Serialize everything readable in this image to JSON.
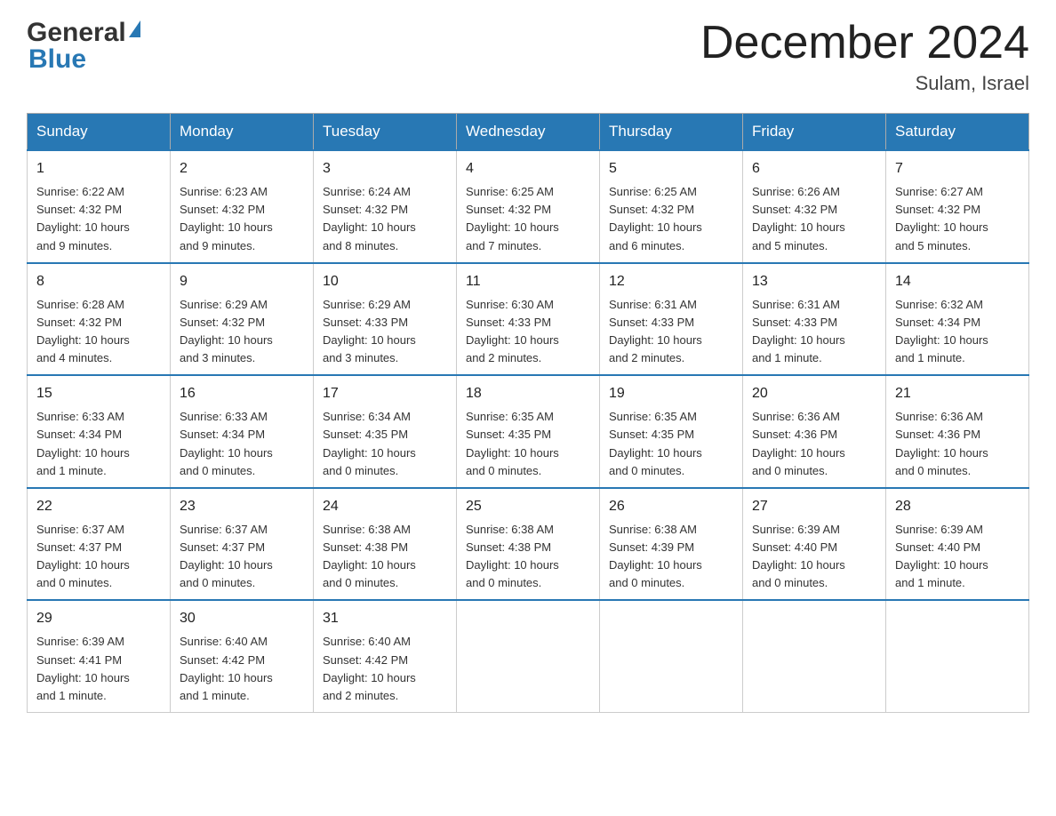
{
  "header": {
    "month_title": "December 2024",
    "location": "Sulam, Israel"
  },
  "days_of_week": [
    "Sunday",
    "Monday",
    "Tuesday",
    "Wednesday",
    "Thursday",
    "Friday",
    "Saturday"
  ],
  "weeks": [
    [
      {
        "day": "1",
        "sunrise": "6:22 AM",
        "sunset": "4:32 PM",
        "daylight": "10 hours and 9 minutes."
      },
      {
        "day": "2",
        "sunrise": "6:23 AM",
        "sunset": "4:32 PM",
        "daylight": "10 hours and 9 minutes."
      },
      {
        "day": "3",
        "sunrise": "6:24 AM",
        "sunset": "4:32 PM",
        "daylight": "10 hours and 8 minutes."
      },
      {
        "day": "4",
        "sunrise": "6:25 AM",
        "sunset": "4:32 PM",
        "daylight": "10 hours and 7 minutes."
      },
      {
        "day": "5",
        "sunrise": "6:25 AM",
        "sunset": "4:32 PM",
        "daylight": "10 hours and 6 minutes."
      },
      {
        "day": "6",
        "sunrise": "6:26 AM",
        "sunset": "4:32 PM",
        "daylight": "10 hours and 5 minutes."
      },
      {
        "day": "7",
        "sunrise": "6:27 AM",
        "sunset": "4:32 PM",
        "daylight": "10 hours and 5 minutes."
      }
    ],
    [
      {
        "day": "8",
        "sunrise": "6:28 AM",
        "sunset": "4:32 PM",
        "daylight": "10 hours and 4 minutes."
      },
      {
        "day": "9",
        "sunrise": "6:29 AM",
        "sunset": "4:32 PM",
        "daylight": "10 hours and 3 minutes."
      },
      {
        "day": "10",
        "sunrise": "6:29 AM",
        "sunset": "4:33 PM",
        "daylight": "10 hours and 3 minutes."
      },
      {
        "day": "11",
        "sunrise": "6:30 AM",
        "sunset": "4:33 PM",
        "daylight": "10 hours and 2 minutes."
      },
      {
        "day": "12",
        "sunrise": "6:31 AM",
        "sunset": "4:33 PM",
        "daylight": "10 hours and 2 minutes."
      },
      {
        "day": "13",
        "sunrise": "6:31 AM",
        "sunset": "4:33 PM",
        "daylight": "10 hours and 1 minute."
      },
      {
        "day": "14",
        "sunrise": "6:32 AM",
        "sunset": "4:34 PM",
        "daylight": "10 hours and 1 minute."
      }
    ],
    [
      {
        "day": "15",
        "sunrise": "6:33 AM",
        "sunset": "4:34 PM",
        "daylight": "10 hours and 1 minute."
      },
      {
        "day": "16",
        "sunrise": "6:33 AM",
        "sunset": "4:34 PM",
        "daylight": "10 hours and 0 minutes."
      },
      {
        "day": "17",
        "sunrise": "6:34 AM",
        "sunset": "4:35 PM",
        "daylight": "10 hours and 0 minutes."
      },
      {
        "day": "18",
        "sunrise": "6:35 AM",
        "sunset": "4:35 PM",
        "daylight": "10 hours and 0 minutes."
      },
      {
        "day": "19",
        "sunrise": "6:35 AM",
        "sunset": "4:35 PM",
        "daylight": "10 hours and 0 minutes."
      },
      {
        "day": "20",
        "sunrise": "6:36 AM",
        "sunset": "4:36 PM",
        "daylight": "10 hours and 0 minutes."
      },
      {
        "day": "21",
        "sunrise": "6:36 AM",
        "sunset": "4:36 PM",
        "daylight": "10 hours and 0 minutes."
      }
    ],
    [
      {
        "day": "22",
        "sunrise": "6:37 AM",
        "sunset": "4:37 PM",
        "daylight": "10 hours and 0 minutes."
      },
      {
        "day": "23",
        "sunrise": "6:37 AM",
        "sunset": "4:37 PM",
        "daylight": "10 hours and 0 minutes."
      },
      {
        "day": "24",
        "sunrise": "6:38 AM",
        "sunset": "4:38 PM",
        "daylight": "10 hours and 0 minutes."
      },
      {
        "day": "25",
        "sunrise": "6:38 AM",
        "sunset": "4:38 PM",
        "daylight": "10 hours and 0 minutes."
      },
      {
        "day": "26",
        "sunrise": "6:38 AM",
        "sunset": "4:39 PM",
        "daylight": "10 hours and 0 minutes."
      },
      {
        "day": "27",
        "sunrise": "6:39 AM",
        "sunset": "4:40 PM",
        "daylight": "10 hours and 0 minutes."
      },
      {
        "day": "28",
        "sunrise": "6:39 AM",
        "sunset": "4:40 PM",
        "daylight": "10 hours and 1 minute."
      }
    ],
    [
      {
        "day": "29",
        "sunrise": "6:39 AM",
        "sunset": "4:41 PM",
        "daylight": "10 hours and 1 minute."
      },
      {
        "day": "30",
        "sunrise": "6:40 AM",
        "sunset": "4:42 PM",
        "daylight": "10 hours and 1 minute."
      },
      {
        "day": "31",
        "sunrise": "6:40 AM",
        "sunset": "4:42 PM",
        "daylight": "10 hours and 2 minutes."
      },
      null,
      null,
      null,
      null
    ]
  ],
  "labels": {
    "sunrise": "Sunrise:",
    "sunset": "Sunset:",
    "daylight": "Daylight:"
  }
}
